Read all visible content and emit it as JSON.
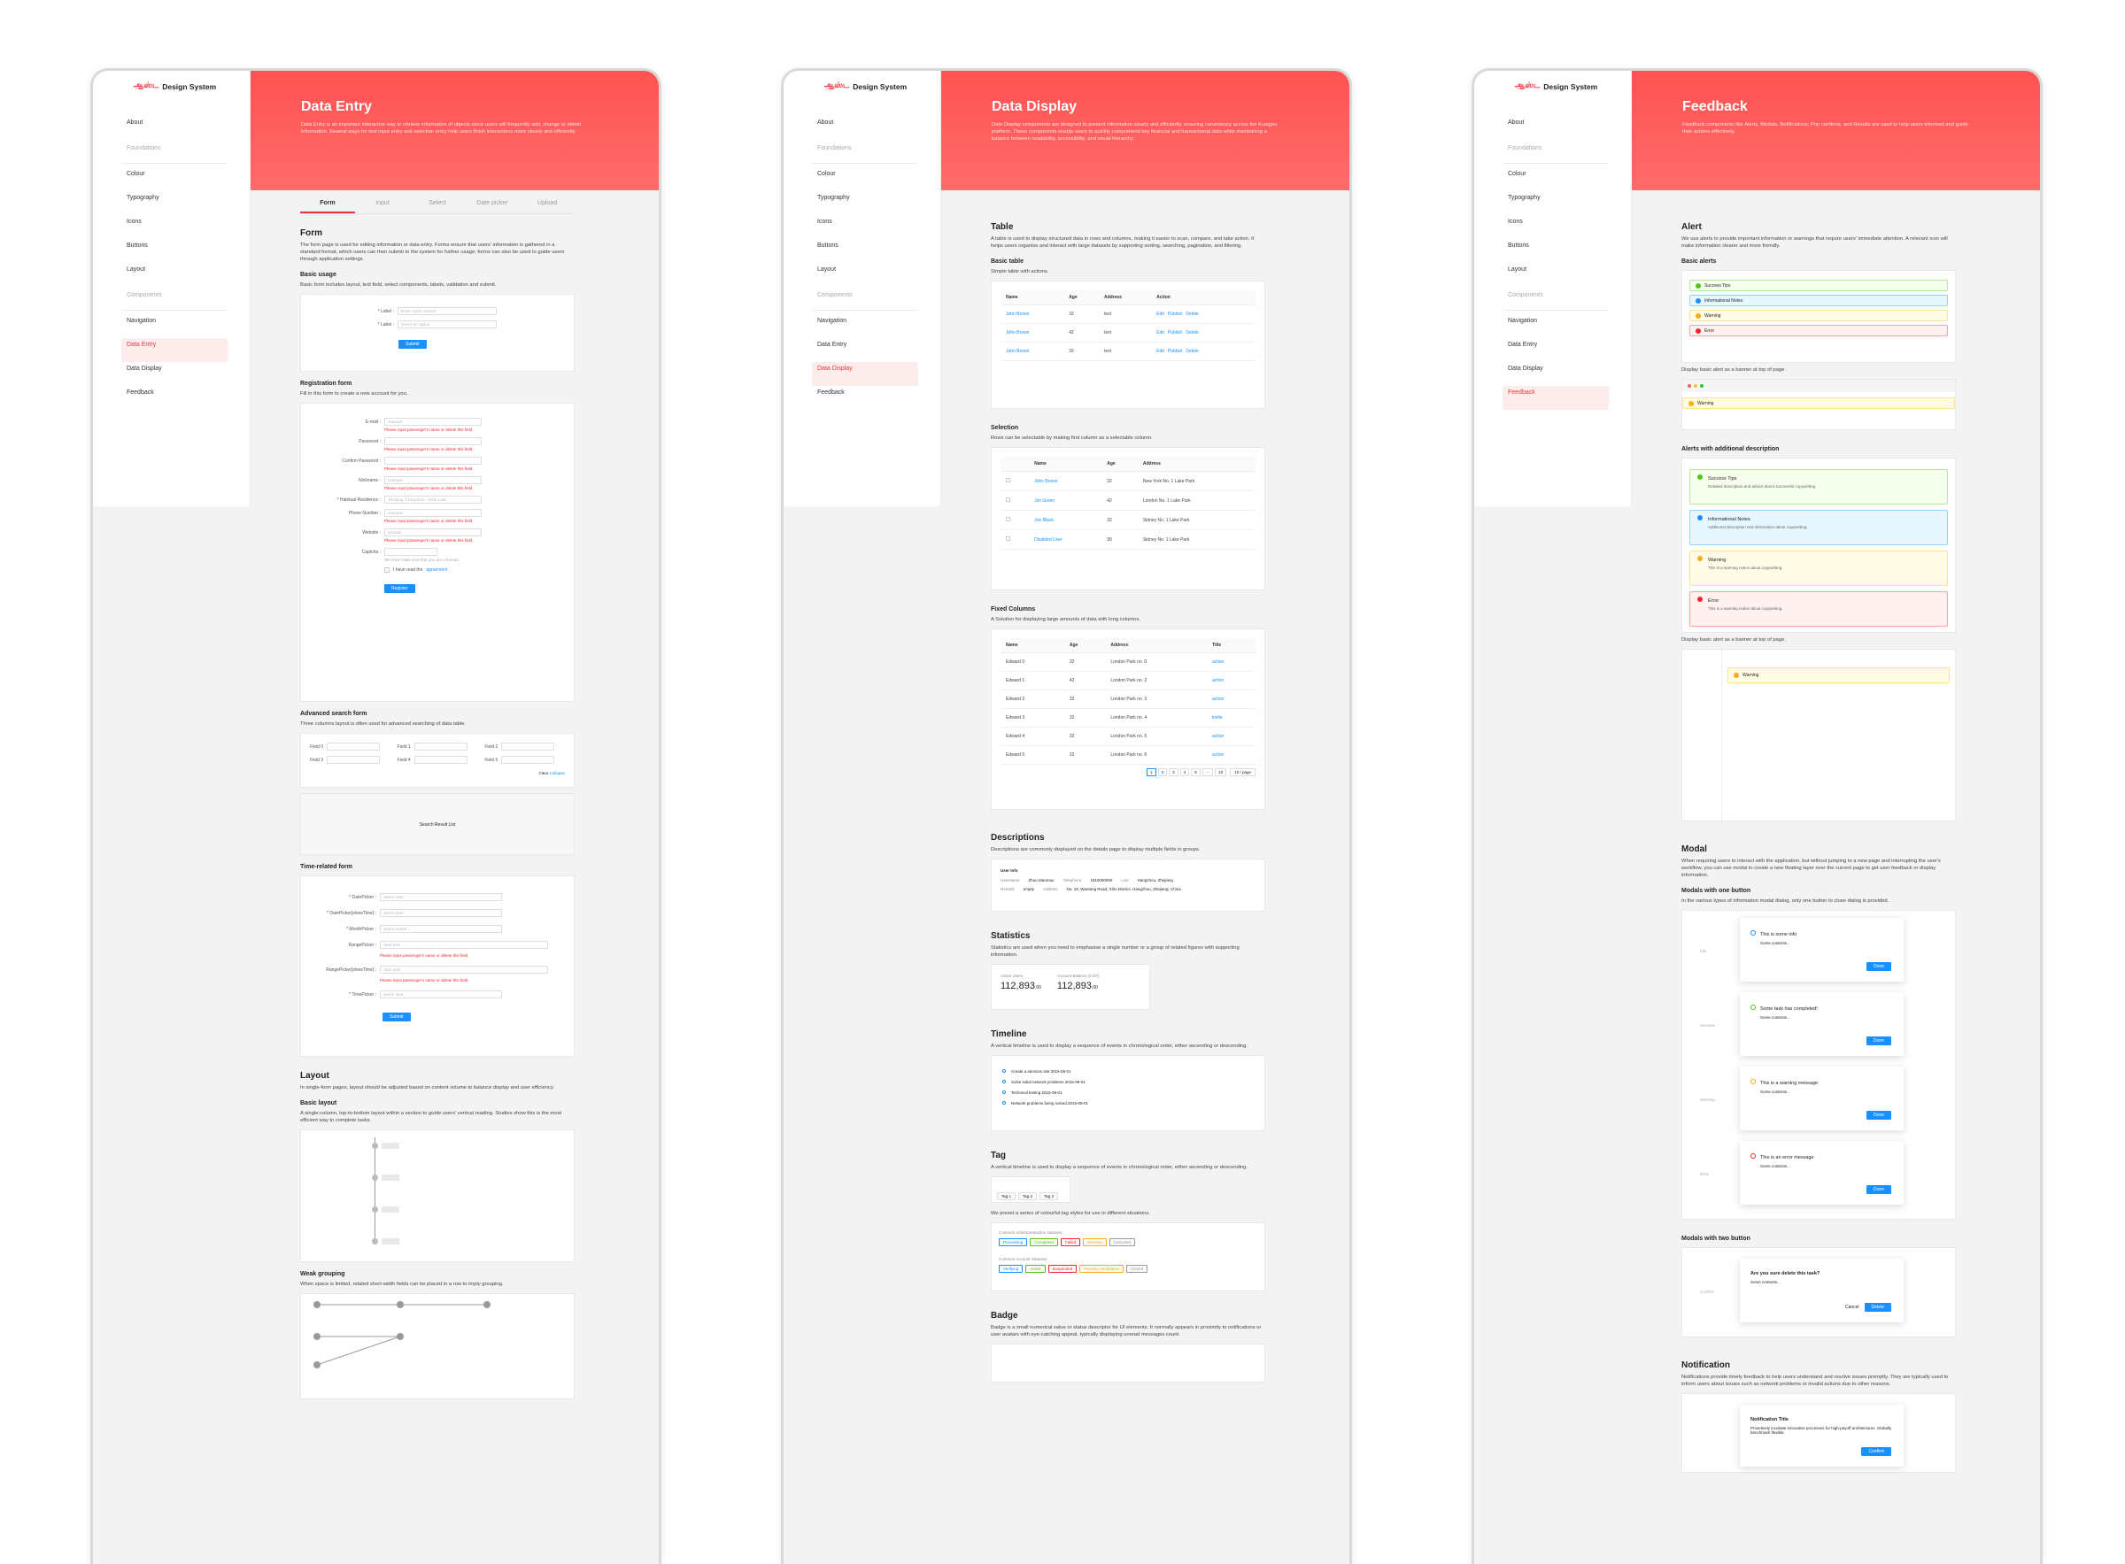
{
  "brand": {
    "mark": "ஆஸ்ட",
    "name": "Design System"
  },
  "nav": [
    {
      "label": "About",
      "cat": false
    },
    {
      "label": "Foundations",
      "cat": true
    },
    {
      "label": "Colour",
      "cat": false
    },
    {
      "label": "Typography",
      "cat": false
    },
    {
      "label": "Icons",
      "cat": false
    },
    {
      "label": "Buttons",
      "cat": false
    },
    {
      "label": "Layout",
      "cat": false
    },
    {
      "label": "Components",
      "cat": true
    },
    {
      "label": "Navigation",
      "cat": false
    },
    {
      "label": "Data Entry",
      "cat": false
    },
    {
      "label": "Data Display",
      "cat": false
    },
    {
      "label": "Feedback",
      "cat": false
    }
  ],
  "p1": {
    "title": "Data Entry",
    "intro": "Data Entry is an important interactive way to retrieve information of objects since users will frequently add, change or delete information. Several ways for text input entry and selection entry help users finish interactions more clearly and efficiently.",
    "tabs": [
      "Form",
      "Input",
      "Select",
      "Date picker",
      "Upload"
    ],
    "form_h": "Form",
    "form_t": "The form page is used for editing information or data entry. Forms ensure that users' information is gathered in a standard format, which users can then submit to the system for further usage; forms can also be used to guide users through application settings.",
    "basic_h": "Basic usage",
    "basic_t": "Basic form includes layout, text field, select components, labels, validation and submit.",
    "basic_fields": [
      {
        "label": "* Label :",
        "ph": "Enter name content"
      },
      {
        "label": "* Label :",
        "ph": "Select an option"
      }
    ],
    "submit": "Submit",
    "reg_h": "Registration form",
    "reg_t": "Fill in this form to create a new account for you.",
    "reg_fields": [
      {
        "label": "E-mail :",
        "ph": "example"
      },
      {
        "label": "Password :",
        "ph": ""
      },
      {
        "label": "Confirm Password :",
        "ph": ""
      },
      {
        "label": "Nickname :",
        "ph": "example"
      },
      {
        "label": "* Habitual Residence :",
        "ph": "Zhejiang / Hangzhou / West Lake"
      },
      {
        "label": "Phone Number :",
        "ph": "example"
      },
      {
        "label": "Website :",
        "ph": "website"
      },
      {
        "label": "Captcha :",
        "ph": ""
      }
    ],
    "reg_err": "Please input passenger's name or delete this field.",
    "captcha_note": "We must make sure that you are a human.",
    "agree": "I have read the",
    "agreement": "agreement",
    "register": "Register",
    "adv_h": "Advanced search form",
    "adv_t": "Three columns layout is often used for advanced searching of data table.",
    "adv_fields": [
      "Field 0",
      "Field 1",
      "Field 2",
      "Field 3",
      "Field 4",
      "Field 5"
    ],
    "clear": "Clear",
    "collapse": "Collapse",
    "result": "Search Result List",
    "time_h": "Time-related form",
    "time_fields": [
      {
        "label": "* DatePicker :",
        "ph": "Select date"
      },
      {
        "label": "* DatePicker[showTime] :",
        "ph": "Select date"
      },
      {
        "label": "* MonthPicker :",
        "ph": "Select month"
      },
      {
        "label": "RangePicker :",
        "ph": "Start date"
      },
      {
        "label": "RangePicker[showTime] :",
        "ph": "Start date"
      },
      {
        "label": "* TimePicker :",
        "ph": "Select time"
      }
    ],
    "layout_h": "Layout",
    "layout_t": "In single-form pages, layout should be adjusted based on content volume to balance display and user efficiency.",
    "blayout_h": "Basic layout",
    "blayout_t": "A single-column, top-to-bottom layout within a section to guide users' vertical reading. Studies show this is the most efficient way to complete tasks.",
    "weak_h": "Weak grouping",
    "weak_t": "When space is limited, related short-width fields can be placed in a row to imply grouping."
  },
  "p2": {
    "title": "Data Display",
    "intro": "Data Display components are designed to present information clearly and efficiently, ensuring consistency across the Kuaigou platform. These components enable users to quickly comprehend key financial and transactional data while maintaining a balance between readability, accessibility, and visual hierarchy.",
    "table_h": "Table",
    "table_t": "A table is used to display structured data in rows and columns, making it easier to scan, compare, and take action. It helps users organise and interact with large datasets by supporting sorting, searching, pagination, and filtering.",
    "basic_h": "Basic table",
    "basic_t": "Simple table with actions.",
    "basic_cols": [
      "Name",
      "Age",
      "Address",
      "Action"
    ],
    "basic_rows": [
      [
        "John Brown",
        "32",
        "text"
      ],
      [
        "John Brown",
        "42",
        "text"
      ],
      [
        "John Brown",
        "32",
        "text"
      ]
    ],
    "actions": [
      "Edit",
      "Publish",
      "Delete"
    ],
    "sel_h": "Selection",
    "sel_t": "Rows can be selectable by making first column as a selectable column.",
    "sel_cols": [
      "Name",
      "Age",
      "Address"
    ],
    "sel_rows": [
      [
        "John Brown",
        "32",
        "New York No. 1 Lake Park"
      ],
      [
        "Jim Green",
        "42",
        "London No. 1 Lake Park"
      ],
      [
        "Joe Black",
        "32",
        "Sidney No. 1 Lake Park"
      ],
      [
        "Disabled User",
        "99",
        "Sidney No. 1 Lake Park"
      ]
    ],
    "fix_h": "Fixed Columns",
    "fix_t": "A Solution for displaying large amounts of data with long columns.",
    "fix_cols": [
      "Name",
      "Age",
      "Address",
      "Title"
    ],
    "fix_rows": [
      [
        "Edward 0",
        "32",
        "London Park no. 0",
        "action"
      ],
      [
        "Edward 1",
        "42",
        "London Park no. 2",
        "action"
      ],
      [
        "Edward 2",
        "32",
        "London Park no. 3",
        "action"
      ],
      [
        "Edward 3",
        "32",
        "London Park no. 4",
        "invite"
      ],
      [
        "Edward 4",
        "32",
        "London Park no. 5",
        "action"
      ],
      [
        "Edward 5",
        "32",
        "London Park no. 6",
        "action"
      ]
    ],
    "pages": [
      "1",
      "2",
      "3",
      "4",
      "5",
      "···",
      "10"
    ],
    "per_page": "10 / page",
    "desc_h": "Descriptions",
    "desc_t": "Descriptions are commonly displayed on the details page to display multiple fields in groups.",
    "desc_title": "User Info",
    "desc_rows": [
      [
        "UserName",
        "Zhou Maomao",
        "Telephone",
        "1810000000",
        "Live",
        "Hangzhou, Zhejiang"
      ],
      [
        "Remark",
        "empty",
        "Address",
        "No. 18, Wantang Road, Xihu District, Hangzhou, Zhejiang, China",
        "",
        ""
      ]
    ],
    "stat_h": "Statistics",
    "stat_t": "Statistics are used when you need to emphasise a single number or a group of related figures with supporting information.",
    "stats": [
      {
        "label": "Active Users",
        "value": "112,893",
        "dec": ".00"
      },
      {
        "label": "Account Balance (CNY)",
        "value": "112,893",
        "dec": ".00"
      }
    ],
    "tl_h": "Timeline",
    "tl_t": "A vertical timeline is used to display a sequence of events in chronological order, either ascending or descending.",
    "tl": [
      "Create a services site 2015-09-01",
      "Solve initial network problems 2015-09-01",
      "Technical testing 2015-09-01",
      "Network problems being solved 2015-09-01"
    ],
    "tag_h": "Tag",
    "tag_t": "A vertical timeline is used to display a sequence of events in chronological order, either ascending or descending.",
    "tags": [
      "Tag 1",
      "Tag 2",
      "Tag 3"
    ],
    "tag_t2": "We preset a series of colourful tag styles for use in different situations.",
    "tag_g1": "Common order/transaction statuses:",
    "tags1": [
      "Processing",
      "Completed",
      "Failed",
      "Pending",
      "Canceled"
    ],
    "tag_g2": "Common Account Statuses:",
    "tags2": [
      "Verifying",
      "Active",
      "Suspended",
      "Pending Verification",
      "Closed"
    ],
    "badge_h": "Badge",
    "badge_t": "Badge is a small numerical value or status descriptor for UI elements. It normally appears in proximity to notifications or user avatars with eye-catching appeal, typically displaying unread messages count."
  },
  "p3": {
    "title": "Feedback",
    "intro": "Feedback components like Alerts, Modals, Notifications, Pop confirms, and Results are used to help users informed and guide their actions effectively.",
    "alert_h": "Alert",
    "alert_t": "We use alerts to provide important information or warnings that require users' immediate attention. A relevant icon will make information clearer and more friendly.",
    "balert_h": "Basic alerts",
    "alerts": [
      "Success Tips",
      "Informational Notes",
      "Warning",
      "Error"
    ],
    "banner_t": "Display basic alert as a banner at top of page.",
    "banner_warn": "Warning",
    "add_h": "Alerts with additional description",
    "alerts2": [
      {
        "t": "Success Tips",
        "d": "Detailed description and advice about successful copywriting."
      },
      {
        "t": "Informational Notes",
        "d": "Additional description and information about copywriting."
      },
      {
        "t": "Warning",
        "d": "This is a warning notice about copywriting."
      },
      {
        "t": "Error",
        "d": "This is a warning notice about copywriting."
      }
    ],
    "banner_t2": "Display basic alert as a banner at top of page.",
    "modal_h": "Modal",
    "modal_t": "When requiring users to interact with the application, but without jumping to a new page and interrupting the user's workflow, you can use modal to create a new floating layer over the current page to get user feedback or display information.",
    "m1_h": "Modals with one button",
    "m1_t": "In the various types of information modal dialog, only one button to close dialog is provided.",
    "modals": [
      {
        "lab": "Info",
        "t": "This is some info",
        "d": "Some contents..."
      },
      {
        "lab": "Success",
        "t": "Some task has completed!",
        "d": "Some contents..."
      },
      {
        "lab": "Warning",
        "t": "This is a warning message",
        "d": "Some contents..."
      },
      {
        "lab": "Error",
        "t": "This is an error message",
        "d": "Some contents..."
      }
    ],
    "done": "Done",
    "m2_h": "Modals with two button",
    "m2_lab": "Confirm",
    "m2_t": "Are you sure delete this task?",
    "m2_d": "Some contents...",
    "cancel": "Cancel",
    "delete": "Delete",
    "notif_h": "Notification",
    "notif_t": "Notifications provide timely feedback to help users understand and resolve issues promptly. They are typically used to inform users about issues such as network problems or invalid actions due to other reasons.",
    "notif_title": "Notification Title",
    "notif_d": "Proactively incubate innovative processes for high-payoff architectures. Globally benchmark flexible.",
    "confirm": "Confirm"
  },
  "colors": {
    "accent": "#e8353b",
    "primary": "#1890ff"
  }
}
